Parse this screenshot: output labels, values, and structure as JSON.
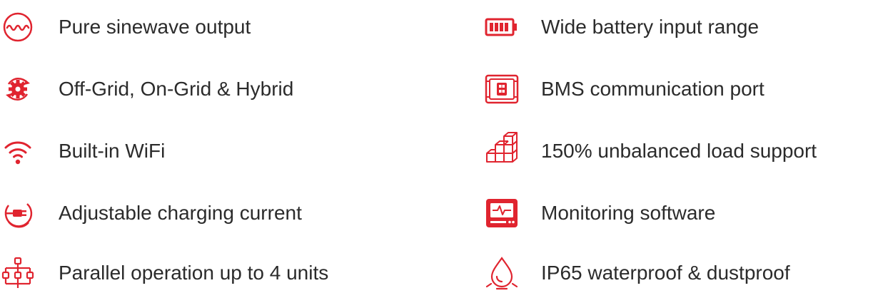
{
  "accent_color": "#e0242f",
  "features_left": [
    {
      "icon": "sinewave-icon",
      "label": "Pure sinewave output"
    },
    {
      "icon": "gear-cycle-icon",
      "label": "Off-Grid, On-Grid & Hybrid"
    },
    {
      "icon": "wifi-icon",
      "label": "Built-in WiFi"
    },
    {
      "icon": "plug-icon",
      "label": "Adjustable charging current"
    },
    {
      "icon": "parallel-units-icon",
      "label": "Parallel operation up to 4 units"
    }
  ],
  "features_right": [
    {
      "icon": "battery-icon",
      "label": "Wide battery input range"
    },
    {
      "icon": "bms-port-icon",
      "label": "BMS communication port"
    },
    {
      "icon": "stacked-cubes-icon",
      "label": "150% unbalanced load support"
    },
    {
      "icon": "monitor-icon",
      "label": "Monitoring software"
    },
    {
      "icon": "water-drop-icon",
      "label": "IP65 waterproof & dustproof"
    }
  ]
}
